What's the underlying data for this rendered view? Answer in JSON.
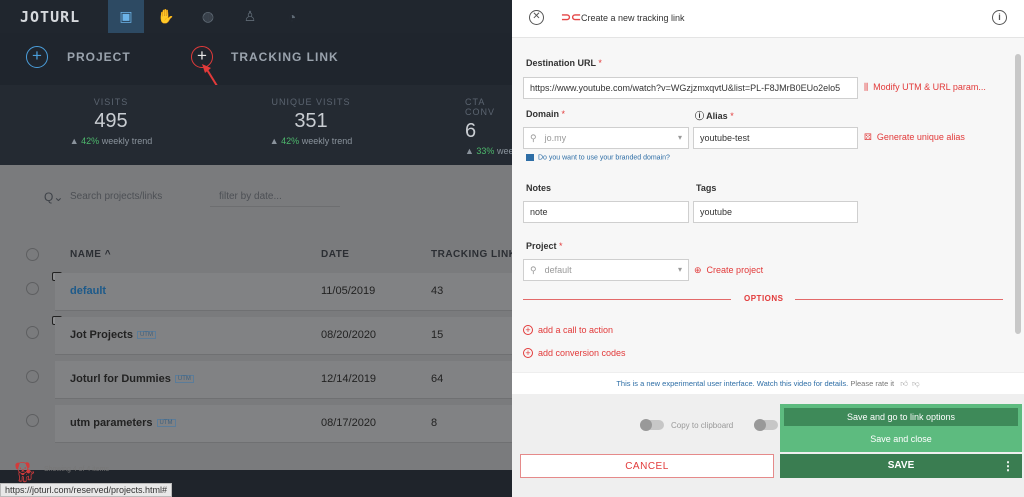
{
  "left": {
    "logo": "JOTURL",
    "actions": {
      "project": "PROJECT",
      "tracking_link": "TRACKING LINK"
    },
    "stats": [
      {
        "label": "VISITS",
        "value": "495",
        "pct": "42%",
        "trend": "weekly trend"
      },
      {
        "label": "UNIQUE VISITS",
        "value": "351",
        "pct": "42%",
        "trend": "weekly trend"
      },
      {
        "label": "CTA CONV",
        "value": "6",
        "pct": "33%",
        "trend": "weekly t"
      }
    ],
    "search_placeholder": "Search projects/links",
    "date_placeholder": "filter by date...",
    "columns": {
      "name": "NAME",
      "date": "DATE",
      "tracking": "TRACKING LINKS"
    },
    "rows": [
      {
        "name": "default",
        "date": "11/05/2019",
        "count": "43",
        "utm": ""
      },
      {
        "name": "Jot Projects",
        "date": "08/20/2020",
        "count": "15",
        "utm": "UTM"
      },
      {
        "name": "Joturl for Dummies",
        "date": "12/14/2019",
        "count": "64",
        "utm": "UTM"
      },
      {
        "name": "utm parameters",
        "date": "08/17/2020",
        "count": "8",
        "utm": "UTM"
      }
    ],
    "showing": "Showing 4 of 4 items",
    "status_url": "https://joturl.com/reserved/projects.html#"
  },
  "panel": {
    "title": "Create a new tracking link",
    "destination": {
      "label": "Destination URL",
      "value": "https://www.youtube.com/watch?v=WGzjzmxqvtU&list=PL-F8JMrB0EUo2elo5",
      "modify": "Modify UTM & URL param..."
    },
    "domain": {
      "label": "Domain",
      "placeholder": "jo.my"
    },
    "alias": {
      "label": "Alias",
      "value": "youtube-test",
      "generate": "Generate unique alias"
    },
    "branded_question": "Do you want to use your branded domain?",
    "notes": {
      "label": "Notes",
      "value": "note"
    },
    "tags": {
      "label": "Tags",
      "value": "youtube"
    },
    "project": {
      "label": "Project",
      "placeholder": "default",
      "create": "Create project"
    },
    "options_label": "OPTIONS",
    "add_cta": "add a call to action",
    "add_conversion": "add conversion codes",
    "experimental": "This is a new experimental user interface. Watch this video for details.",
    "rate": "Please rate it",
    "copy_clipboard": "Copy to clipboard",
    "cancel": "CANCEL",
    "save_options": [
      "Save and go to link options",
      "Save and close"
    ],
    "save": "SAVE"
  },
  "colors": {
    "accent_red": "#e23a3a",
    "save_green": "#3a7d51",
    "link_blue": "#2e6ea6"
  }
}
